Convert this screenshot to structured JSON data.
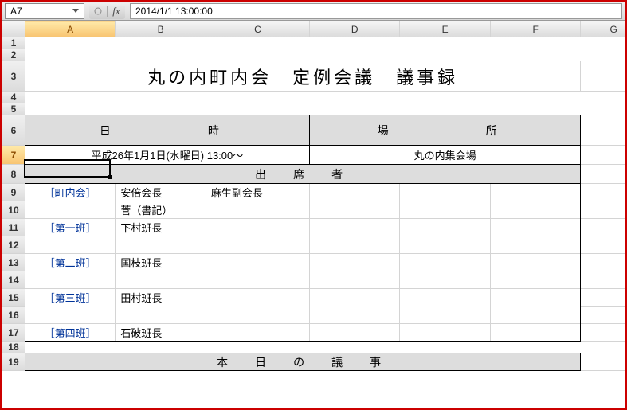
{
  "nameBox": "A7",
  "formula": "2014/1/1  13:00:00",
  "columns": [
    "A",
    "B",
    "C",
    "D",
    "E",
    "F",
    "G"
  ],
  "rowNums": [
    "1",
    "2",
    "3",
    "4",
    "5",
    "6",
    "7",
    "8",
    "9",
    "10",
    "11",
    "12",
    "13",
    "14",
    "15",
    "16",
    "17",
    "18",
    "19"
  ],
  "title": "丸の内町内会　定例会議　議事録",
  "headers": {
    "datetime": "日　　　時",
    "place": "場　　　所",
    "attendees": "出　席　者",
    "agenda": "本　日　の　議　事"
  },
  "values": {
    "datetime": "平成26年1月1日(水曜日) 13:00～",
    "place": "丸の内集会場"
  },
  "attendees": {
    "groups": [
      {
        "label": "［町内会］",
        "members": [
          "安倍会長",
          "麻生副会長",
          "菅（書記）"
        ]
      },
      {
        "label": "［第一班］",
        "members": [
          "下村班長"
        ]
      },
      {
        "label": "［第二班］",
        "members": [
          "国枝班長"
        ]
      },
      {
        "label": "［第三班］",
        "members": [
          "田村班長"
        ]
      },
      {
        "label": "［第四班］",
        "members": [
          "石破班長"
        ]
      }
    ]
  },
  "activeCell": {
    "row": 7,
    "col": "A"
  }
}
